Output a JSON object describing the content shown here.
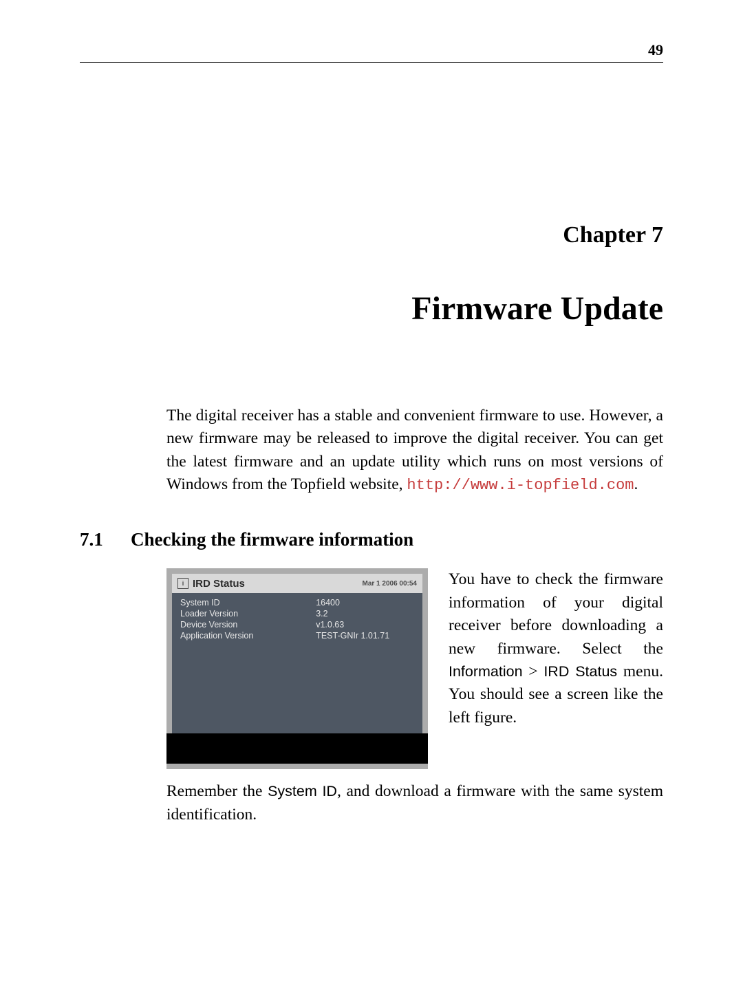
{
  "page_number": "49",
  "chapter_label": "Chapter 7",
  "chapter_title": "Firmware Update",
  "intro": {
    "text_before_link": "The digital receiver has a stable and convenient firmware to use. However, a new firmware may be released to improve the digital receiver. You can get the latest firmware and an update utility which runs on most versions of Windows from the Topfield website, ",
    "link": "http://www.i-topfield.com",
    "text_after_link": "."
  },
  "section": {
    "number": "7.1",
    "title": "Checking the firmware information"
  },
  "figure": {
    "titlebar_icon_glyph": "i",
    "title": "IRD Status",
    "timestamp": "Mar 1 2006 00:54",
    "rows": [
      {
        "label": "System ID",
        "value": "16400"
      },
      {
        "label": "Loader Version",
        "value": "3.2"
      },
      {
        "label": "Device Version",
        "value": "v1.0.63"
      },
      {
        "label": "Application Version",
        "value": "TEST-GNIr 1.01.71"
      }
    ]
  },
  "right_text": {
    "p1_before_menu": "You have to check the firmware information of your digital receiver before downloading a new firmware. Select the ",
    "menu_path_1": "Information",
    "menu_sep": " > ",
    "menu_path_2": "IRD Status",
    "p1_after_menu": " menu. You should see a screen like the left figure."
  },
  "after": {
    "before_sans": "Remember the ",
    "sans": "System ID",
    "after_sans": ", and download a firmware with the same system identification."
  }
}
